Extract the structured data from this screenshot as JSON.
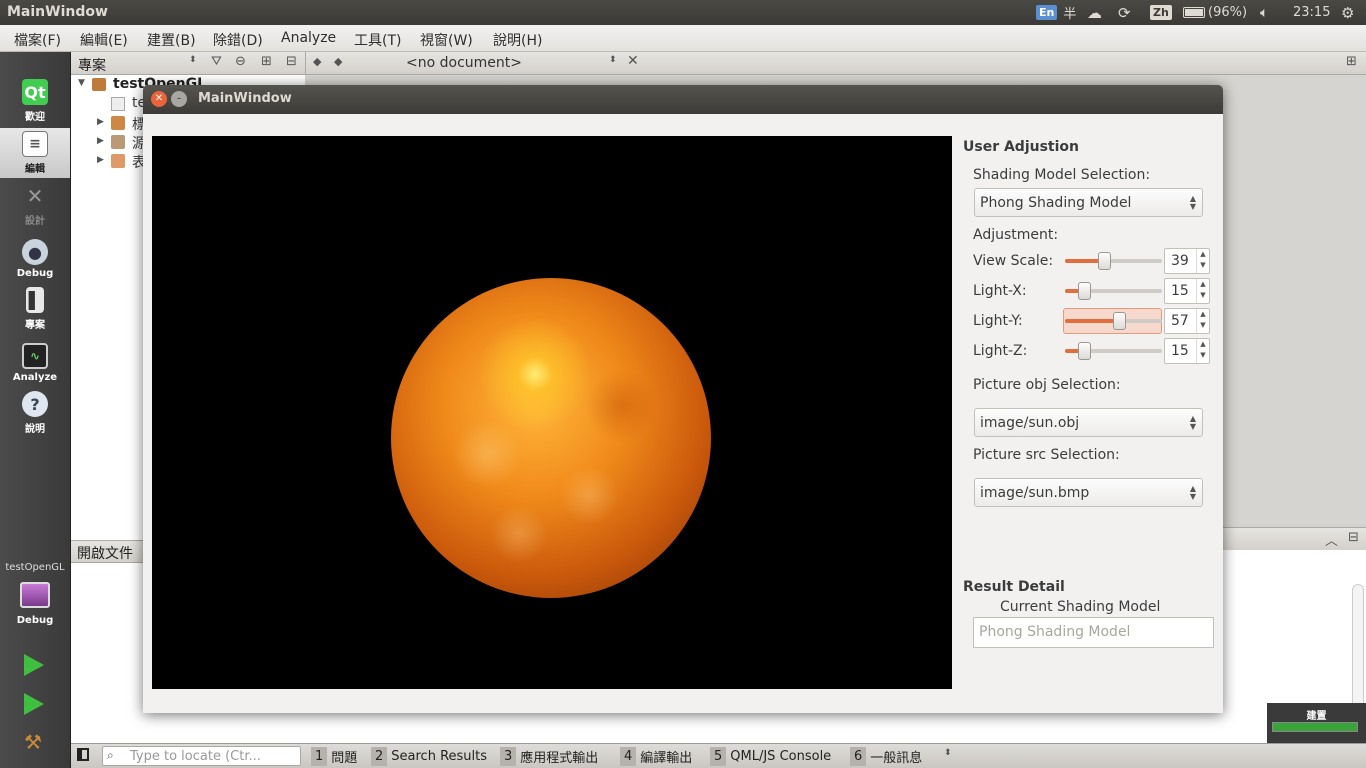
{
  "topbar": {
    "title": "MainWindow",
    "lang": "En",
    "half": "半",
    "zh": "Zh",
    "battery": "(96%)",
    "time": "23:15"
  },
  "menu": [
    "檔案(F)",
    "編輯(E)",
    "建置(B)",
    "除錯(D)",
    "Analyze",
    "工具(T)",
    "視窗(W)",
    "說明(H)"
  ],
  "modes": [
    {
      "label": "歡迎",
      "icon": "qt-logo-icon"
    },
    {
      "label": "編輯",
      "icon": "edit-document-icon"
    },
    {
      "label": "設計",
      "icon": "design-tools-icon"
    },
    {
      "label": "Debug",
      "icon": "debug-bug-icon"
    },
    {
      "label": "專案",
      "icon": "project-icon"
    },
    {
      "label": "Analyze",
      "icon": "analyze-scope-icon"
    },
    {
      "label": "說明",
      "icon": "help-icon"
    }
  ],
  "kit": {
    "project": "testOpenGL",
    "config": "Debug"
  },
  "project_pane": {
    "header": "專案",
    "root": "testOpenGL",
    "children": [
      "te",
      "標",
      "源",
      "表"
    ]
  },
  "open_docs": {
    "header": "開啟文件"
  },
  "editor": {
    "document": "<no document>"
  },
  "statusbar": {
    "locate_placeholder": "Type to locate (Ctr...",
    "tabs": [
      {
        "num": "1",
        "label": "問題"
      },
      {
        "num": "2",
        "label": "Search Results"
      },
      {
        "num": "3",
        "label": "應用程式輸出"
      },
      {
        "num": "4",
        "label": "編譯輸出"
      },
      {
        "num": "5",
        "label": "QML/JS Console"
      },
      {
        "num": "6",
        "label": "一般訊息"
      }
    ],
    "build_label": "建置",
    "build_progress": 1.0
  },
  "main_window": {
    "title": "MainWindow",
    "user_adjustion": "User Adjustion",
    "shading_label": "Shading Model Selection:",
    "shading_value": "Phong Shading Model",
    "adjustment": "Adjustment:",
    "sliders": [
      {
        "label": "View Scale:",
        "value": "39",
        "fraction": 0.39
      },
      {
        "label": "Light-X:",
        "value": "15",
        "fraction": 0.15
      },
      {
        "label": "Light-Y:",
        "value": "57",
        "fraction": 0.57
      },
      {
        "label": "Light-Z:",
        "value": "15",
        "fraction": 0.15
      }
    ],
    "obj_label": "Picture obj Selection:",
    "obj_value": "image/sun.obj",
    "src_label": "Picture src Selection:",
    "src_value": "image/sun.bmp",
    "result_detail": "Result Detail",
    "current_model_label": "Current Shading Model",
    "current_model_value": "Phong Shading Model"
  },
  "colors": {
    "accent": "#e36d3c",
    "panel": "#3c3b37",
    "window_bg": "#f2f1f0"
  }
}
